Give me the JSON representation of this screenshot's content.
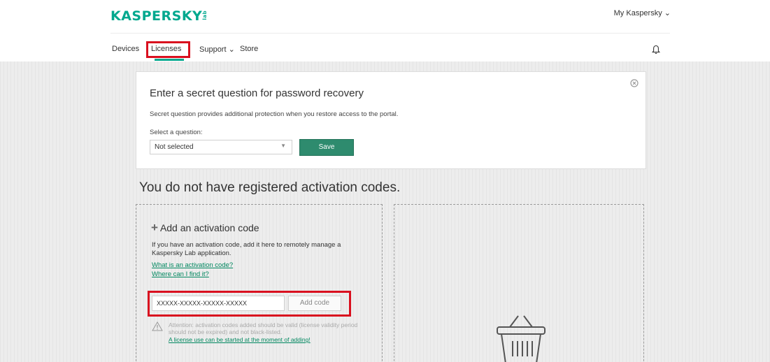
{
  "header": {
    "logo_text": "KASPERSKY",
    "logo_suffix": "lab",
    "account_menu": "My Kaspersky ⌄"
  },
  "nav": {
    "devices": "Devices",
    "licenses": "Licenses",
    "support": "Support ⌄",
    "store": "Store"
  },
  "secret_question": {
    "title": "Enter a secret question for password recovery",
    "description": "Secret question provides additional protection when you restore access to the portal.",
    "select_label": "Select a question:",
    "select_value": "Not selected",
    "save_label": "Save"
  },
  "main": {
    "heading": "You do not have registered activation codes."
  },
  "add_code": {
    "title": "Add an activation code",
    "description": "If you have an activation code, add it here to remotely manage a Kaspersky Lab application.",
    "link_what": "What is an activation code?",
    "link_where": "Where can I find it?",
    "input_value": "XXXXX-XXXXX-XXXXX-XXXXX",
    "button_label": "Add code",
    "warning": "Attention: activation codes added should be valid (license validity period should not be expired) and not black-listed.",
    "warning_link": "A license use can be started at the moment of adding!"
  },
  "colors": {
    "brand": "#00a88e",
    "button": "#2e8b6e",
    "highlight": "#d9101f"
  },
  "icons": [
    "bell-icon",
    "close-icon",
    "chevron-down-icon",
    "plus-icon",
    "warning-icon",
    "basket-icon"
  ]
}
